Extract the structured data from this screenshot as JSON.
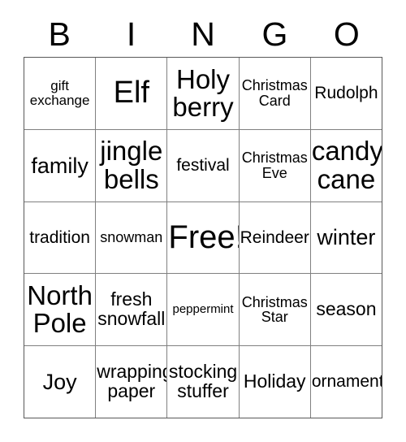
{
  "card": {
    "header": {
      "letters": [
        "B",
        "I",
        "N",
        "G",
        "O"
      ]
    },
    "rows": [
      {
        "cells": [
          {
            "text": "gift\nexchange",
            "size": "fs-sm"
          },
          {
            "text": "Elf",
            "size": "fs-xxl"
          },
          {
            "text": "Holy\nberry",
            "size": "fs-xl"
          },
          {
            "text": "Christmas\nCard",
            "size": "fs-smp"
          },
          {
            "text": "Rudolph",
            "size": "fs-md"
          }
        ]
      },
      {
        "cells": [
          {
            "text": "family",
            "size": "fs-lg"
          },
          {
            "text": "jingle\nbells",
            "size": "fs-xl"
          },
          {
            "text": "festival",
            "size": "fs-md"
          },
          {
            "text": "Christmas\nEve",
            "size": "fs-smp"
          },
          {
            "text": "candy\ncane",
            "size": "fs-xl"
          }
        ]
      },
      {
        "cells": [
          {
            "text": "tradition",
            "size": "fs-md"
          },
          {
            "text": "snowman",
            "size": "fs-smp"
          },
          {
            "text": "Free!",
            "size": "fs-free"
          },
          {
            "text": "Reindeer",
            "size": "fs-md"
          },
          {
            "text": "winter",
            "size": "fs-lg"
          }
        ]
      },
      {
        "cells": [
          {
            "text": "North\nPole",
            "size": "fs-xl"
          },
          {
            "text": "fresh\nsnowfall",
            "size": "fs-mdp"
          },
          {
            "text": "peppermint",
            "size": "fs-xs"
          },
          {
            "text": "Christmas\nStar",
            "size": "fs-smp"
          },
          {
            "text": "season",
            "size": "fs-mdp"
          }
        ]
      },
      {
        "cells": [
          {
            "text": "Joy",
            "size": "fs-lg"
          },
          {
            "text": "wrapping\npaper",
            "size": "fs-mdp"
          },
          {
            "text": "stocking\nstuffer",
            "size": "fs-mdp"
          },
          {
            "text": "Holiday",
            "size": "fs-mdp"
          },
          {
            "text": "ornament",
            "size": "fs-md"
          }
        ]
      }
    ],
    "colors": {
      "background": "#ffffff",
      "text": "#000000",
      "grid_line": "#808080",
      "grid_border": "#595959"
    }
  }
}
